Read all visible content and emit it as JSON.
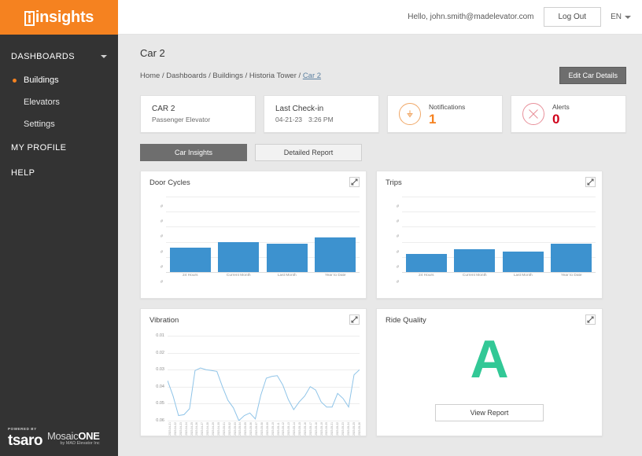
{
  "brand": {
    "logo_text": "insights",
    "logo_initial": "i"
  },
  "topbar": {
    "greeting": "Hello, john.smith@madelevator.com",
    "logout_label": "Log Out",
    "language": "EN"
  },
  "sidebar": {
    "dashboards_label": "DASHBOARDS",
    "items": [
      {
        "label": "Buildings",
        "active": true
      },
      {
        "label": "Elevators",
        "active": false
      },
      {
        "label": "Settings",
        "active": false
      }
    ],
    "my_profile_label": "MY PROFILE",
    "help_label": "HELP"
  },
  "footer": {
    "powered_by": "POWERED BY",
    "tsaro": "tsaro",
    "mosaic_prefix": "Mosaic",
    "mosaic_suffix": "ONE",
    "mosaic_sub": "by MAD Elevator Inc"
  },
  "header": {
    "page_title": "Car 2",
    "breadcrumb_trail": "Home / Dashboards / Buildings / Historia Tower / ",
    "breadcrumb_current": "Car 2",
    "edit_button": "Edit Car Details"
  },
  "stats": {
    "car": {
      "title": "CAR 2",
      "subtitle": "Passenger Elevator"
    },
    "checkin": {
      "title": "Last Check-in",
      "date": "04-21-23",
      "time": "3:26 PM"
    },
    "notifications": {
      "label": "Notifications",
      "value": "1",
      "color": "#f58220"
    },
    "alerts": {
      "label": "Alerts",
      "value": "0",
      "color": "#d0021b"
    }
  },
  "tabs": [
    {
      "label": "Car Insights",
      "active": true
    },
    {
      "label": "Detailed Report",
      "active": false
    }
  ],
  "panels": {
    "door_cycles_title": "Door Cycles",
    "trips_title": "Trips",
    "vibration_title": "Vibration",
    "ride_quality_title": "Ride Quality",
    "expand_icon": "expand-icon"
  },
  "ride_quality": {
    "grade": "A",
    "view_report_label": "View Report"
  },
  "chart_data": [
    {
      "type": "bar",
      "title": "Door Cycles",
      "categories": [
        "24 Hours",
        "Current Month",
        "Last Month",
        "Year to Date"
      ],
      "values": [
        32,
        40,
        37,
        46
      ],
      "ylim": [
        0,
        100
      ],
      "ytick_labels": [
        "#",
        "#",
        "#",
        "#",
        "#",
        "#"
      ],
      "xlabel": "",
      "ylabel": "",
      "grid": true,
      "legend": "none",
      "bar_color": "#3d92cf"
    },
    {
      "type": "bar",
      "title": "Trips",
      "categories": [
        "24 Hours",
        "Current Month",
        "Last Month",
        "Year to Date"
      ],
      "values": [
        24,
        30,
        27,
        38
      ],
      "ylim": [
        0,
        100
      ],
      "ytick_labels": [
        "#",
        "#",
        "#",
        "#",
        "#",
        "#"
      ],
      "xlabel": "",
      "ylabel": "",
      "grid": true,
      "legend": "none",
      "bar_color": "#3d92cf"
    },
    {
      "type": "line",
      "title": "Vibration",
      "ytick_labels": [
        "0.01",
        "0.02",
        "0.03",
        "0.04",
        "0.05",
        "0.06"
      ],
      "ylim": [
        0.06,
        0.01
      ],
      "y_inverted": true,
      "grid": true,
      "legend": "none",
      "line_color": "#8fc4e8",
      "x": [
        "2023-04-21",
        "2023-04-22",
        "2023-04-23",
        "2023-04-24",
        "2023-04-25",
        "2023-04-26",
        "2023-04-27",
        "2023-04-28",
        "2023-04-29",
        "2023-04-30",
        "2023-05-01",
        "2023-05-02",
        "2023-05-03",
        "2023-05-04",
        "2023-05-05",
        "2023-05-06",
        "2023-05-07",
        "2023-05-08",
        "2023-05-09",
        "2023-05-10",
        "2023-05-11",
        "2023-05-12",
        "2023-05-13",
        "2023-05-14",
        "2023-05-15",
        "2023-05-16",
        "2023-05-17",
        "2023-05-18",
        "2023-05-19",
        "2023-05-20",
        "2023-05-21",
        "2023-05-22",
        "2023-05-23",
        "2023-05-24",
        "2023-05-25",
        "2023-05-26"
      ],
      "values": [
        0.0365,
        0.0455,
        0.057,
        0.0565,
        0.053,
        0.0305,
        0.029,
        0.03,
        0.0305,
        0.031,
        0.04,
        0.048,
        0.0525,
        0.06,
        0.057,
        0.0555,
        0.059,
        0.045,
        0.035,
        0.034,
        0.0335,
        0.039,
        0.0475,
        0.0535,
        0.049,
        0.0455,
        0.04,
        0.042,
        0.049,
        0.052,
        0.052,
        0.044,
        0.047,
        0.052,
        0.033,
        0.03
      ]
    }
  ]
}
